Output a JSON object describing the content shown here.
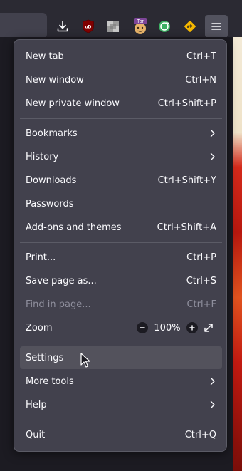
{
  "toolbar": {
    "extensions": [
      {
        "icon": "download-icon"
      },
      {
        "icon": "ublock-origin-icon",
        "text": "uD"
      },
      {
        "icon": "grid-extension-icon"
      },
      {
        "icon": "tor-extension-icon",
        "text": "Tor"
      },
      {
        "icon": "sync-extension-icon"
      },
      {
        "icon": "direction-sign-icon"
      },
      {
        "icon": "hamburger-menu-icon"
      }
    ]
  },
  "menu": {
    "new_tab": {
      "label": "New tab",
      "shortcut": "Ctrl+T"
    },
    "new_window": {
      "label": "New window",
      "shortcut": "Ctrl+N"
    },
    "new_private_window": {
      "label": "New private window",
      "shortcut": "Ctrl+Shift+P"
    },
    "bookmarks": {
      "label": "Bookmarks"
    },
    "history": {
      "label": "History"
    },
    "downloads": {
      "label": "Downloads",
      "shortcut": "Ctrl+Shift+Y"
    },
    "passwords": {
      "label": "Passwords"
    },
    "addons": {
      "label": "Add-ons and themes",
      "shortcut": "Ctrl+Shift+A"
    },
    "print": {
      "label": "Print...",
      "shortcut": "Ctrl+P"
    },
    "save_page": {
      "label": "Save page as...",
      "shortcut": "Ctrl+S"
    },
    "find_in_page": {
      "label": "Find in page...",
      "shortcut": "Ctrl+F"
    },
    "zoom": {
      "label": "Zoom",
      "value": "100%"
    },
    "settings": {
      "label": "Settings"
    },
    "more_tools": {
      "label": "More tools"
    },
    "help": {
      "label": "Help"
    },
    "quit": {
      "label": "Quit",
      "shortcut": "Ctrl+Q"
    }
  },
  "colors": {
    "menu_bg": "#42414d",
    "hover_bg": "#53525c",
    "text": "#fbfbfe",
    "disabled_text": "#8f8f9d",
    "ublock_red": "#800000",
    "tor_purple": "#7d4698",
    "sign_yellow": "#f5b700"
  }
}
